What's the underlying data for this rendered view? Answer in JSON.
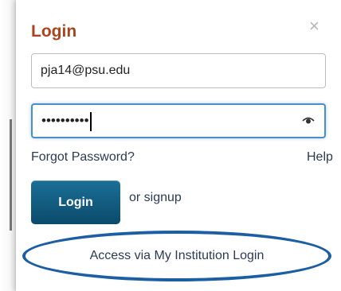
{
  "login_panel": {
    "title": "Login",
    "close_glyph": "×",
    "email": {
      "value": "pja14@psu.edu"
    },
    "password": {
      "masked_value": "••••••••••"
    },
    "forgot_password_label": "Forgot Password?",
    "help_label": "Help",
    "login_button_label": "Login",
    "signup_text": "or signup",
    "institution_login_label": "Access via My Institution Login"
  },
  "colors": {
    "title": "#a9441c",
    "button": "#0b4a6b",
    "highlight_oval": "#1c5ea2",
    "focus_border": "#4a8fcc"
  },
  "icons": [
    "close-icon",
    "eye-icon"
  ]
}
